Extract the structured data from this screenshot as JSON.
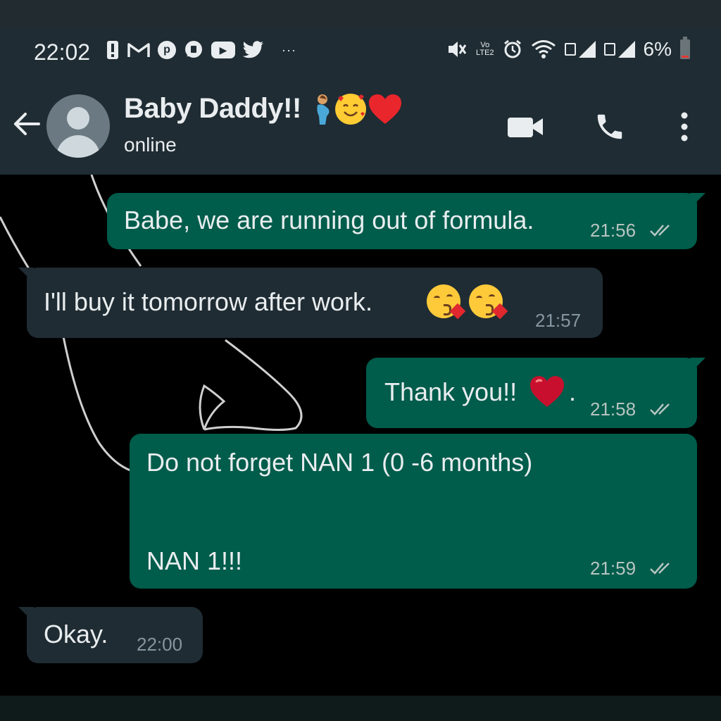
{
  "status_bar": {
    "time": "22:02",
    "more": "···",
    "network_label": "Vo\nLTE2",
    "battery": "6%"
  },
  "header": {
    "contact_name": "Baby Daddy!!",
    "contact_status": "online",
    "name_emojis": [
      "pregnant-person-emoji",
      "smiling-face-with-hearts-emoji",
      "red-heart-emoji"
    ],
    "icons": [
      "back-arrow-icon",
      "video-call-icon",
      "voice-call-icon",
      "more-options-icon"
    ]
  },
  "messages": [
    {
      "direction": "outgoing",
      "text": "Babe, we are running out of formula.",
      "time": "21:56",
      "status": "read"
    },
    {
      "direction": "incoming",
      "text": "I'll buy it tomorrow  after  work.",
      "time": "21:57",
      "emojis": [
        "face-blowing-kiss-emoji",
        "face-blowing-kiss-emoji"
      ]
    },
    {
      "direction": "outgoing",
      "text": "Thank you!!",
      "text_after": ".",
      "time": "21:58",
      "status": "read",
      "emojis": [
        "heart-emoji"
      ]
    },
    {
      "direction": "outgoing",
      "text": "Do not forget NAN 1 (0 -6 months)",
      "text_line2": "NAN 1!!!",
      "time": "21:59",
      "status": "read"
    },
    {
      "direction": "incoming",
      "text": "Okay.",
      "time": "22:00"
    }
  ],
  "colors": {
    "outgoing_bubble": "#005c4b",
    "incoming_bubble": "#1f2c33",
    "header": "#1f2c33",
    "chat_background": "#000000",
    "text": "#e9edef"
  }
}
